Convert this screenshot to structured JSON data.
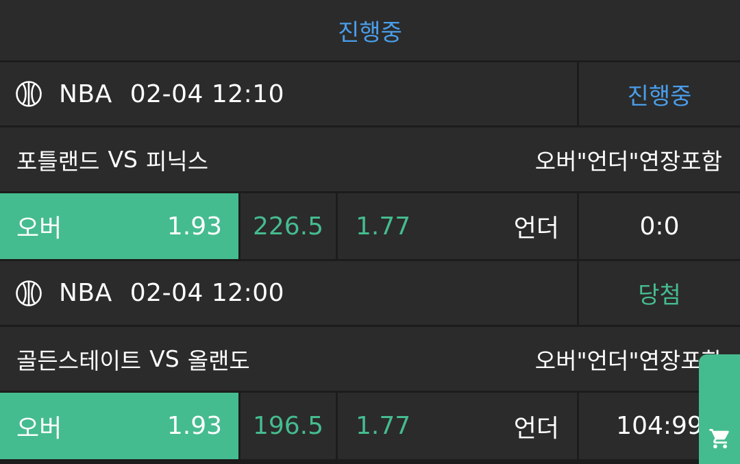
{
  "header": {
    "status": "진행중"
  },
  "colors": {
    "accent_green": "#45bc8f",
    "accent_blue": "#4a9eea",
    "cell_bg": "#2b2b2b",
    "divider": "#1c1c1c"
  },
  "games": [
    {
      "sport_icon": "basketball-icon",
      "league": "NBA",
      "datetime": "02-04 12:10",
      "status": "진행중",
      "status_color": "#4a9eea",
      "home": "포틀랜드",
      "vs": "VS",
      "away": "피닉스",
      "rule": "오버\"언더\"연장포함",
      "over_label": "오버",
      "over_odds": "1.93",
      "line": "226.5",
      "under_odds": "1.77",
      "under_label": "언더",
      "score": "0:0"
    },
    {
      "sport_icon": "basketball-icon",
      "league": "NBA",
      "datetime": "02-04 12:00",
      "status": "당첨",
      "status_color": "#45bc8f",
      "home": "골든스테이트",
      "vs": "VS",
      "away": "올랜도",
      "rule": "오버\"언더\"연장포함",
      "over_label": "오버",
      "over_odds": "1.93",
      "line": "196.5",
      "under_odds": "1.77",
      "under_label": "언더",
      "score": "104:99"
    }
  ],
  "cart": {
    "icon": "cart-icon"
  }
}
